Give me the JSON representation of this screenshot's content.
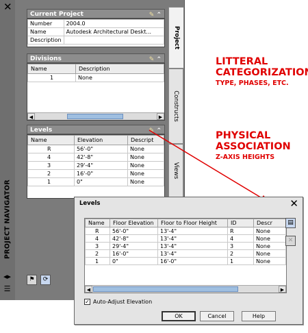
{
  "navigator": {
    "title": "PROJECT NAVIGATOR",
    "close_glyph": "✕",
    "current_project": {
      "heading": "Current Project",
      "rows": [
        {
          "label": "Number",
          "value": "2004.0"
        },
        {
          "label": "Name",
          "value": "Autodesk Architectural Deskt..."
        },
        {
          "label": "Description",
          "value": ""
        }
      ]
    },
    "divisions": {
      "heading": "Divisions",
      "columns": [
        "Name",
        "Description"
      ],
      "rows": [
        [
          "1",
          "None"
        ]
      ]
    },
    "levels": {
      "heading": "Levels",
      "columns": [
        "Name",
        "Elevation",
        "Descript"
      ],
      "rows": [
        [
          "R",
          "56'-0\"",
          "None"
        ],
        [
          "4",
          "42'-8\"",
          "None"
        ],
        [
          "3",
          "29'-4\"",
          "None"
        ],
        [
          "2",
          "16'-0\"",
          "None"
        ],
        [
          "1",
          "0\"",
          "None"
        ]
      ]
    },
    "tabs": [
      "Project",
      "Constructs",
      "Views"
    ]
  },
  "annotations": {
    "categorization_title_line1": "LITTERAL",
    "categorization_title_line2": "CATEGORIZATION",
    "categorization_sub": "TYPE, PHASES, ETC.",
    "association_title_line1": "PHYSICAL",
    "association_title_line2": "ASSOCIATION",
    "association_sub": "Z-AXIS HEIGHTS"
  },
  "dialog": {
    "title": "Levels",
    "columns": [
      "Name",
      "Floor Elevation",
      "Floor to Floor Height",
      "ID",
      "Descr"
    ],
    "rows": [
      [
        "R",
        "56'-0\"",
        "13'-4\"",
        "R",
        "None"
      ],
      [
        "4",
        "42'-8\"",
        "13'-4\"",
        "4",
        "None"
      ],
      [
        "3",
        "29'-4\"",
        "13'-4\"",
        "3",
        "None"
      ],
      [
        "2",
        "16'-0\"",
        "13'-4\"",
        "2",
        "None"
      ],
      [
        "1",
        "0\"",
        "16'-0\"",
        "1",
        "None"
      ]
    ],
    "auto_adjust_label": "Auto-Adjust Elevation",
    "auto_adjust_checked": true,
    "ok_label": "OK",
    "cancel_label": "Cancel",
    "help_label": "Help"
  },
  "colors": {
    "annotation": "#e00000",
    "panel": "#7b7b7b",
    "scroll_thumb": "#9fbfe0"
  }
}
